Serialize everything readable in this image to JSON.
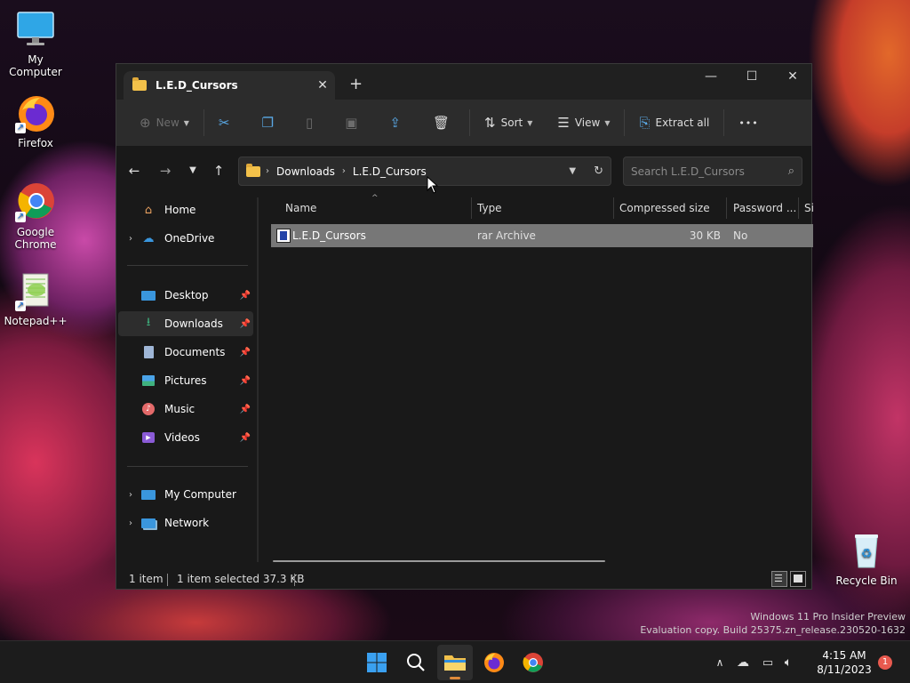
{
  "desktop": {
    "icons": [
      {
        "label": "My Computer"
      },
      {
        "label": "Firefox"
      },
      {
        "label": "Google Chrome"
      },
      {
        "label": "Notepad++"
      },
      {
        "label": "Recycle Bin"
      }
    ],
    "watermark_line1": "Windows 11 Pro Insider Preview",
    "watermark_line2": "Evaluation copy. Build 25375.zn_release.230520-1632"
  },
  "window": {
    "tab_title": "L.E.D_Cursors",
    "toolbar": {
      "new_label": "New",
      "sort_label": "Sort",
      "view_label": "View",
      "extract_label": "Extract all",
      "more_label": "•••"
    },
    "address": {
      "crumbs": [
        "Downloads",
        "L.E.D_Cursors"
      ]
    },
    "search": {
      "placeholder": "Search L.E.D_Cursors"
    },
    "sidebar": {
      "items": [
        {
          "label": "Home"
        },
        {
          "label": "OneDrive"
        },
        {
          "label": "Desktop"
        },
        {
          "label": "Downloads"
        },
        {
          "label": "Documents"
        },
        {
          "label": "Pictures"
        },
        {
          "label": "Music"
        },
        {
          "label": "Videos"
        },
        {
          "label": "My Computer"
        },
        {
          "label": "Network"
        }
      ]
    },
    "columns": [
      "Name",
      "Type",
      "Compressed size",
      "Password ...",
      "Si"
    ],
    "files": [
      {
        "name": "L.E.D_Cursors",
        "type": "rar Archive",
        "compressed_size": "30 KB",
        "password": "No"
      }
    ],
    "status": {
      "count": "1 item",
      "selected": "1 item selected 37.3 KB"
    }
  },
  "taskbar": {
    "time": "4:15 AM",
    "date": "8/11/2023",
    "notification_count": "1"
  },
  "colors": {
    "accent": "#0078d4",
    "folder": "#f3c14a",
    "selected_row": "#777777"
  }
}
